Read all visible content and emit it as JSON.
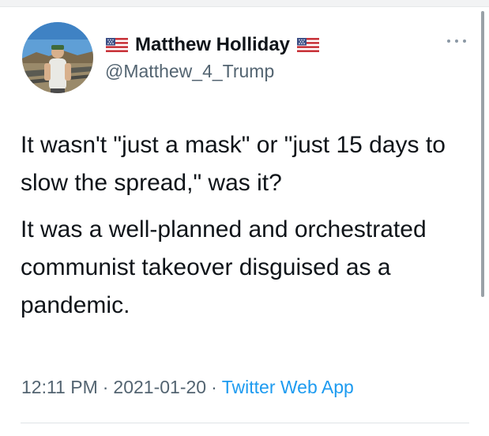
{
  "tweet": {
    "author": {
      "display_name": "Matthew Holliday",
      "handle": "@Matthew_4_Trump",
      "name_prefix_icon": "us-flag-icon",
      "name_suffix_icon": "us-flag-icon"
    },
    "paragraphs": [
      "It wasn't \"just a mask\" or \"just 15 days to slow the spread,\" was it?",
      "It was a well-planned and orchestrated communist takeover disguised as a pandemic."
    ],
    "time": "12:11 PM",
    "date": "2021-01-20",
    "separator": "·",
    "source": "Twitter Web App"
  },
  "icons": {
    "more": "more-options-icon"
  },
  "colors": {
    "text": "#0f1419",
    "secondary": "#536471",
    "link": "#1d9bf0"
  }
}
